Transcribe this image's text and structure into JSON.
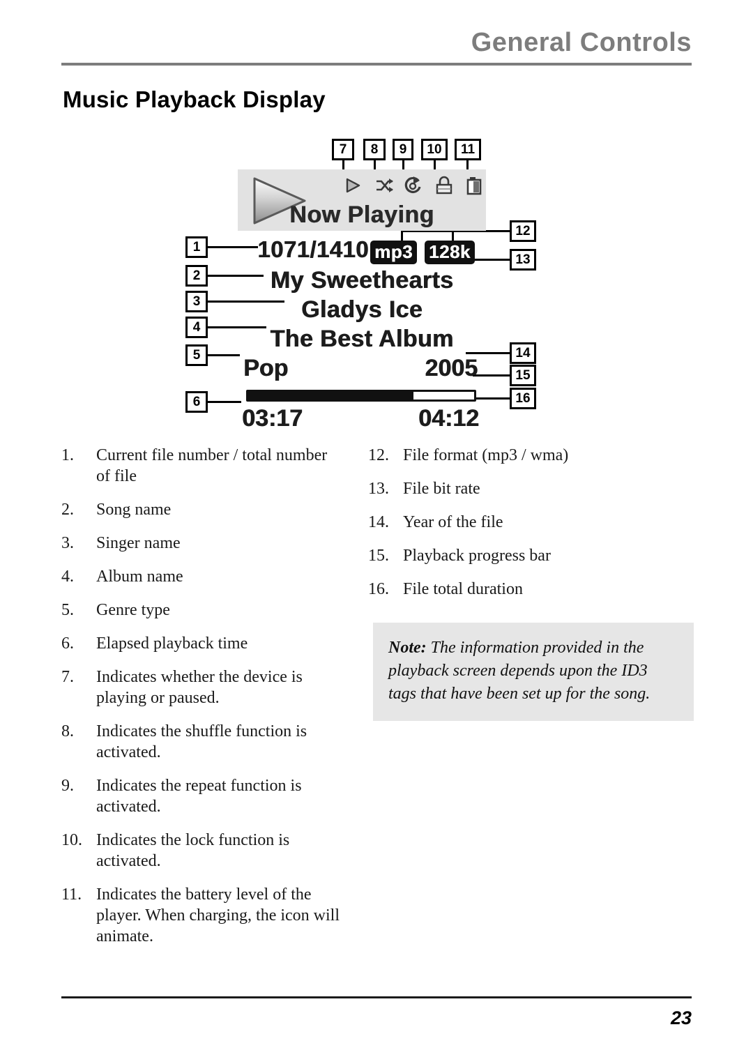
{
  "header": {
    "title": "General Controls",
    "section_heading": "Music Playback Display"
  },
  "figure": {
    "lcd": {
      "banner_text": "Now Playing",
      "file_number": "1071/1410",
      "song_name": "My Sweethearts",
      "singer_name": "Gladys Ice",
      "album_name": "The Best Album",
      "genre": "Pop",
      "year": "2005",
      "file_format": "mp3",
      "bit_rate": "128k",
      "elapsed_time": "03:17",
      "total_duration": "04:12",
      "progress_percent": 73,
      "icons": [
        {
          "name": "play-icon",
          "label": "play"
        },
        {
          "name": "shuffle-icon",
          "label": "shuffle"
        },
        {
          "name": "repeat-icon",
          "label": "repeat"
        },
        {
          "name": "lock-icon",
          "label": "lock"
        },
        {
          "name": "battery-icon",
          "label": "battery"
        }
      ]
    },
    "callouts": {
      "c1": "1",
      "c2": "2",
      "c3": "3",
      "c4": "4",
      "c5": "5",
      "c6": "6",
      "c7": "7",
      "c8": "8",
      "c9": "9",
      "c10": "10",
      "c11": "11",
      "c12": "12",
      "c13": "13",
      "c14": "14",
      "c15": "15",
      "c16": "16"
    }
  },
  "legend": {
    "left": [
      {
        "num": "1.",
        "text": "Current file number / total number of file"
      },
      {
        "num": "2.",
        "text": "Song name"
      },
      {
        "num": "3.",
        "text": "Singer name"
      },
      {
        "num": "4.",
        "text": "Album name"
      },
      {
        "num": "5.",
        "text": "Genre type"
      },
      {
        "num": "6.",
        "text": "Elapsed playback time"
      },
      {
        "num": "7.",
        "text": "Indicates whether the device is playing or paused."
      },
      {
        "num": "8.",
        "text": "Indicates the shuffle function is activated."
      },
      {
        "num": "9.",
        "text": "Indicates the repeat function is activated."
      },
      {
        "num": "10.",
        "text": "Indicates the lock function is activated."
      },
      {
        "num": "11.",
        "text": "Indicates the battery level of the player. When charging, the icon will animate."
      }
    ],
    "right": [
      {
        "num": "12.",
        "text": "File format (mp3 / wma)"
      },
      {
        "num": "13.",
        "text": "File bit rate"
      },
      {
        "num": "14.",
        "text": "Year of the file"
      },
      {
        "num": "15.",
        "text": "Playback progress bar"
      },
      {
        "num": "16.",
        "text": "File total duration"
      }
    ]
  },
  "note": {
    "label": "Note:",
    "text": " The information provided in the playback screen depends upon the ID3 tags that have been set up for the song."
  },
  "footer": {
    "page_number": "23"
  },
  "colors": {
    "header_gray": "#7d7d7d",
    "lcd_banner_gray": "#e2e2e2",
    "note_bg_gray": "#e6e6e6",
    "ink": "#111111"
  }
}
